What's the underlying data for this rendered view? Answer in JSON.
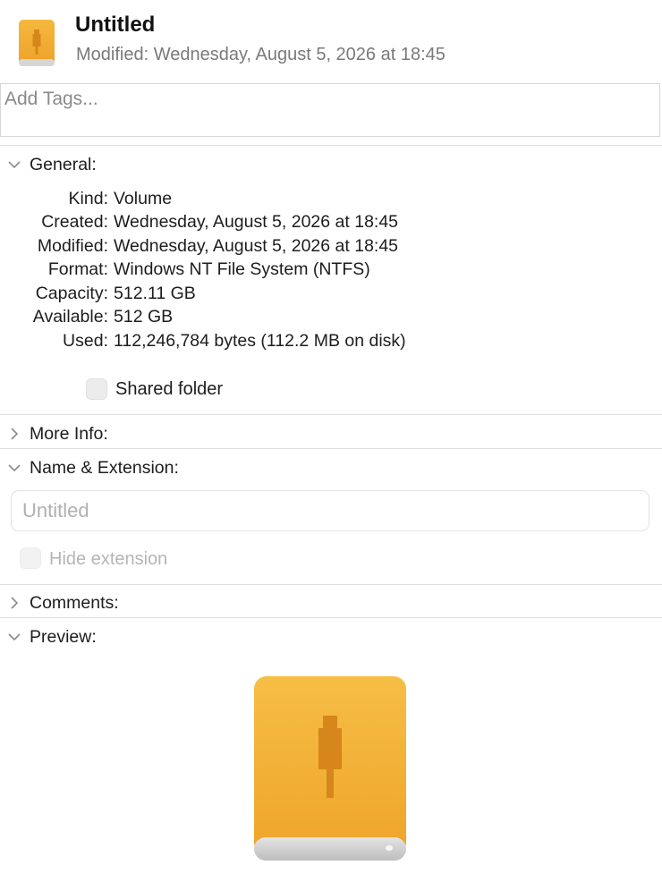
{
  "header": {
    "title": "Untitled",
    "modified_label": "Modified:",
    "modified_value": "Wednesday, August 5, 2026 at 18:45",
    "icon": "usb-drive-icon"
  },
  "tags": {
    "placeholder": "Add Tags..."
  },
  "general": {
    "title": "General:",
    "expanded": true,
    "rows": [
      {
        "label": "Kind:",
        "value": "Volume"
      },
      {
        "label": "Created:",
        "value": "Wednesday, August 5, 2026 at 18:45"
      },
      {
        "label": "Modified:",
        "value": "Wednesday, August 5, 2026 at 18:45"
      },
      {
        "label": "Format:",
        "value": "Windows NT File System (NTFS)"
      },
      {
        "label": "Capacity:",
        "value": "512.11 GB"
      },
      {
        "label": "Available:",
        "value": "512 GB"
      },
      {
        "label": "Used:",
        "value": "112,246,784 bytes (112.2 MB on disk)"
      }
    ],
    "shared_folder_label": "Shared folder",
    "shared_folder_checked": false
  },
  "more_info": {
    "title": "More Info:",
    "expanded": false
  },
  "name_extension": {
    "title": "Name & Extension:",
    "expanded": true,
    "name_value": "Untitled",
    "hide_extension_label": "Hide extension",
    "hide_extension_checked": false
  },
  "comments": {
    "title": "Comments:",
    "expanded": false
  },
  "preview": {
    "title": "Preview:",
    "expanded": true,
    "icon": "usb-drive-icon"
  },
  "colors": {
    "drive_orange": "#F1AE33",
    "drive_orange_dark": "#D58A1C",
    "drive_base": "#D9D9D9",
    "secondary_text": "#7A7A7A"
  }
}
